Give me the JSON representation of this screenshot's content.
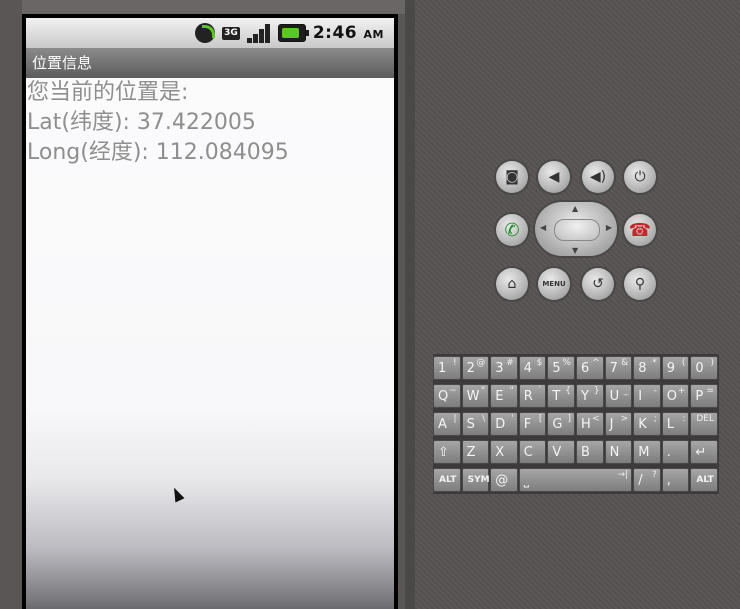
{
  "status_bar": {
    "network": "3G",
    "time": "2:46",
    "ampm": "AM"
  },
  "app": {
    "title": "位置信息",
    "lines": [
      "您当前的位置是:",
      "Lat(纬度): 37.422005",
      "Long(经度): 112.084095"
    ]
  },
  "controls": {
    "menu_label": "MENU"
  },
  "keyboard": {
    "rows": [
      [
        {
          "main": "1",
          "alt": "!"
        },
        {
          "main": "2",
          "alt": "@"
        },
        {
          "main": "3",
          "alt": "#"
        },
        {
          "main": "4",
          "alt": "$"
        },
        {
          "main": "5",
          "alt": "%"
        },
        {
          "main": "6",
          "alt": "^"
        },
        {
          "main": "7",
          "alt": "&"
        },
        {
          "main": "8",
          "alt": "*"
        },
        {
          "main": "9",
          "alt": "("
        },
        {
          "main": "0",
          "alt": ")"
        }
      ],
      [
        {
          "main": "Q",
          "alt": "~"
        },
        {
          "main": "W",
          "alt": "\""
        },
        {
          "main": "E",
          "alt": "\""
        },
        {
          "main": "R",
          "alt": "`"
        },
        {
          "main": "T",
          "alt": "{"
        },
        {
          "main": "Y",
          "alt": "}"
        },
        {
          "main": "U",
          "alt": "_"
        },
        {
          "main": "I",
          "alt": "-"
        },
        {
          "main": "O",
          "alt": "+"
        },
        {
          "main": "P",
          "alt": "="
        }
      ],
      [
        {
          "main": "A",
          "alt": "|"
        },
        {
          "main": "S",
          "alt": "\\"
        },
        {
          "main": "D",
          "alt": "'"
        },
        {
          "main": "F",
          "alt": "["
        },
        {
          "main": "G",
          "alt": "]"
        },
        {
          "main": "H",
          "alt": "<"
        },
        {
          "main": "J",
          "alt": ">"
        },
        {
          "main": "K",
          "alt": ";"
        },
        {
          "main": "L",
          "alt": ":"
        },
        {
          "main": "",
          "alt": "DEL"
        }
      ],
      [
        {
          "main": "⇧",
          "alt": ""
        },
        {
          "main": "Z",
          "alt": ""
        },
        {
          "main": "X",
          "alt": ""
        },
        {
          "main": "C",
          "alt": ""
        },
        {
          "main": "V",
          "alt": ""
        },
        {
          "main": "B",
          "alt": ""
        },
        {
          "main": "N",
          "alt": ""
        },
        {
          "main": "M",
          "alt": ""
        },
        {
          "main": ".",
          "alt": ""
        },
        {
          "main": "↵",
          "alt": ""
        }
      ],
      [
        {
          "main": "ALT",
          "alt": ""
        },
        {
          "main": "SYM",
          "alt": ""
        },
        {
          "main": "@",
          "alt": ""
        },
        {
          "main": "⎵",
          "alt": "→|"
        },
        {
          "main": "/",
          "alt": "?"
        },
        {
          "main": ",",
          "alt": ""
        },
        {
          "main": "ALT",
          "alt": ""
        }
      ]
    ]
  }
}
